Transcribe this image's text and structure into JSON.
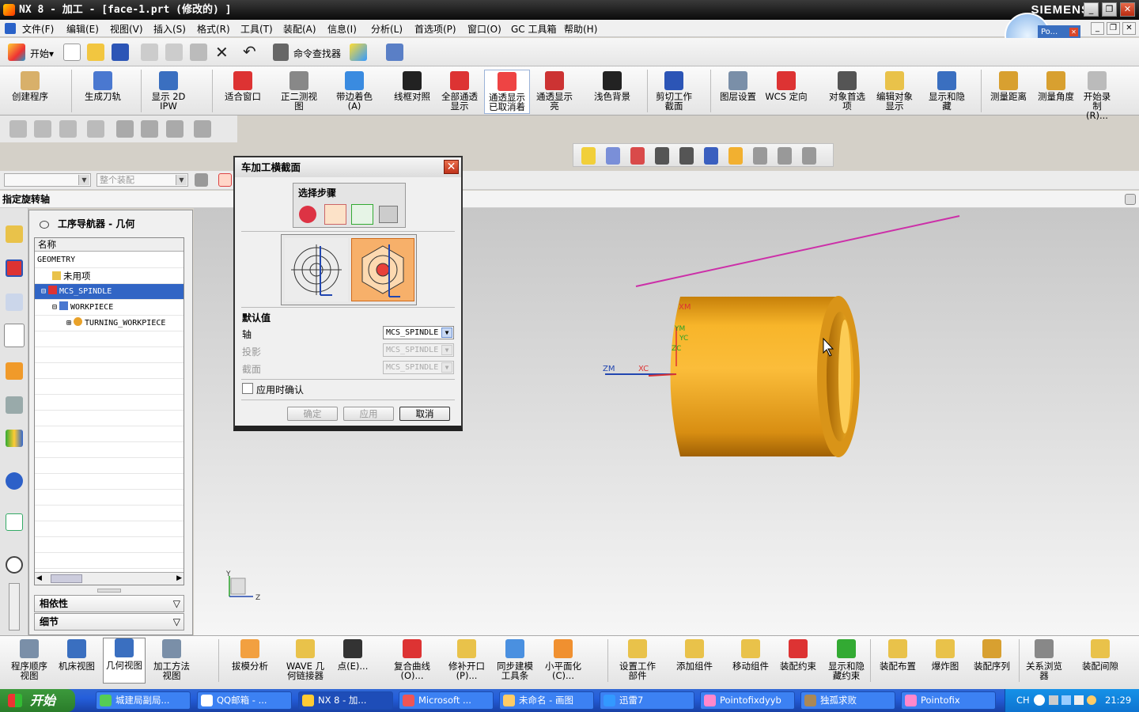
{
  "app": {
    "title": "NX 8 - 加工 - [face-1.prt  (修改的) ]",
    "brand": "SIEMENS"
  },
  "popup": {
    "title": "Po...",
    "start": "开始"
  },
  "menu": [
    "文件(F)",
    "编辑(E)",
    "视图(V)",
    "插入(S)",
    "格式(R)",
    "工具(T)",
    "装配(A)",
    "信息(I)",
    "分析(L)",
    "首选项(P)",
    "窗口(O)",
    "GC 工具箱",
    "帮助(H)"
  ],
  "toolbar": {
    "start": "开始▾",
    "command_finder": "命令查找器"
  },
  "ribbon": [
    {
      "l1": "创建程序",
      "l2": "",
      "icon": "create-program-icon"
    },
    {
      "l1": "生成刀轨",
      "l2": "",
      "icon": "generate-toolpath-icon"
    },
    {
      "l1": "显示 2D",
      "l2": "IPW",
      "icon": "show-2d-ipw-icon"
    },
    {
      "l1": "适合窗口",
      "l2": "",
      "icon": "fit-window-icon"
    },
    {
      "l1": "正二测视",
      "l2": "图",
      "icon": "trimetric-view-icon"
    },
    {
      "l1": "带边着色",
      "l2": "(A)",
      "icon": "shaded-with-edges-icon"
    },
    {
      "l1": "线框对照",
      "l2": "",
      "icon": "wireframe-icon"
    },
    {
      "l1": "全部通透",
      "l2": "显示",
      "icon": "all-translucent-icon"
    },
    {
      "l1": "通透显示",
      "l2": "已取消着",
      "icon": "translucency-off-icon"
    },
    {
      "l1": "通透显示",
      "l2": "亮",
      "icon": "translucency-bright-icon"
    },
    {
      "l1": "浅色背景",
      "l2": "",
      "icon": "light-background-icon"
    },
    {
      "l1": "剪切工作",
      "l2": "截面",
      "icon": "clip-section-icon"
    },
    {
      "l1": "图层设置",
      "l2": "",
      "icon": "layer-settings-icon"
    },
    {
      "l1": "WCS 定向",
      "l2": "",
      "icon": "wcs-orient-icon"
    },
    {
      "l1": "对象首选",
      "l2": "项",
      "icon": "object-preferences-icon"
    },
    {
      "l1": "编辑对象",
      "l2": "显示",
      "icon": "edit-object-display-icon"
    },
    {
      "l1": "显示和隐",
      "l2": "藏",
      "icon": "show-hide-icon"
    },
    {
      "l1": "测量距离",
      "l2": "",
      "icon": "measure-distance-icon"
    },
    {
      "l1": "测量角度",
      "l2": "",
      "icon": "measure-angle-icon"
    },
    {
      "l1": "开始录制",
      "l2": "(R)...",
      "icon": "start-record-icon"
    }
  ],
  "selbar": {
    "filter": "",
    "scope": "整个装配"
  },
  "cue": "指定旋转轴",
  "navigator": {
    "title": "工序导航器 - 几何",
    "col": "名称",
    "rows": [
      "GEOMETRY",
      "未用项",
      "MCS_SPINDLE",
      "WORKPIECE",
      "TURNING_WORKPIECE"
    ],
    "dependencies": "相依性",
    "details": "细节"
  },
  "dialog": {
    "title": "车加工横截面",
    "steps": "选择步骤",
    "defaults": "默认值",
    "axis_label": "轴",
    "axis_value": "MCS_SPINDLE",
    "proj_label": "投影",
    "proj_value": "MCS_SPINDLE",
    "section_label": "截面",
    "section_value": "MCS_SPINDLE",
    "confirm_on_apply": "应用时确认",
    "ok": "确定",
    "apply": "应用",
    "cancel": "取消"
  },
  "viewport": {
    "zm": "ZM",
    "xc": "XC",
    "xm": "XM",
    "ym": "YM",
    "zc": "ZC",
    "yc": "YC",
    "triad_y": "Y",
    "triad_z": "Z"
  },
  "bottom": [
    {
      "l1": "程序顺序",
      "l2": "视图",
      "icon": "program-order-view-icon"
    },
    {
      "l1": "机床视图",
      "l2": "",
      "icon": "machine-view-icon"
    },
    {
      "l1": "几何视图",
      "l2": "",
      "icon": "geometry-view-icon"
    },
    {
      "l1": "加工方法",
      "l2": "视图",
      "icon": "machining-method-view-icon"
    },
    {
      "l1": "拔模分析",
      "l2": "",
      "icon": "draft-analysis-icon"
    },
    {
      "l1": "WAVE 几",
      "l2": "何链接器",
      "icon": "wave-linker-icon"
    },
    {
      "l1": "点(E)...",
      "l2": "",
      "icon": "point-icon"
    },
    {
      "l1": "复合曲线",
      "l2": "(O)...",
      "icon": "composite-curve-icon"
    },
    {
      "l1": "修补开口",
      "l2": "(P)...",
      "icon": "patch-opening-icon"
    },
    {
      "l1": "同步建模",
      "l2": "工具条",
      "icon": "sync-modeling-icon"
    },
    {
      "l1": "小平面化",
      "l2": "(C)...",
      "icon": "facetize-icon"
    },
    {
      "l1": "设置工作",
      "l2": "部件",
      "icon": "set-work-part-icon"
    },
    {
      "l1": "添加组件",
      "l2": "",
      "icon": "add-component-icon"
    },
    {
      "l1": "移动组件",
      "l2": "",
      "icon": "move-component-icon"
    },
    {
      "l1": "装配约束",
      "l2": "",
      "icon": "assembly-constraint-icon"
    },
    {
      "l1": "显示和隐",
      "l2": "藏约束",
      "icon": "show-hide-constraints-icon"
    },
    {
      "l1": "装配布置",
      "l2": "",
      "icon": "assembly-arrangement-icon"
    },
    {
      "l1": "爆炸图",
      "l2": "",
      "icon": "exploded-view-icon"
    },
    {
      "l1": "装配序列",
      "l2": "",
      "icon": "assembly-sequence-icon"
    },
    {
      "l1": "关系浏览",
      "l2": "器",
      "icon": "relation-browser-icon"
    },
    {
      "l1": "装配间隙",
      "l2": "",
      "icon": "assembly-clearance-icon"
    }
  ],
  "taskbar": {
    "start": "开始",
    "tasks": [
      "城建局副局...",
      "QQ邮箱 - ...",
      "NX 8 - 加...",
      "Microsoft ...",
      "未命名 - 画图",
      "迅雷7",
      "Pointofixdyyb",
      "独孤求败",
      "Pointofix"
    ],
    "lang": "CH",
    "clock": "21:29"
  },
  "colors": {
    "accent": "#3165c5",
    "part": "#f0a81e",
    "magenta": "#cc2fa8"
  }
}
